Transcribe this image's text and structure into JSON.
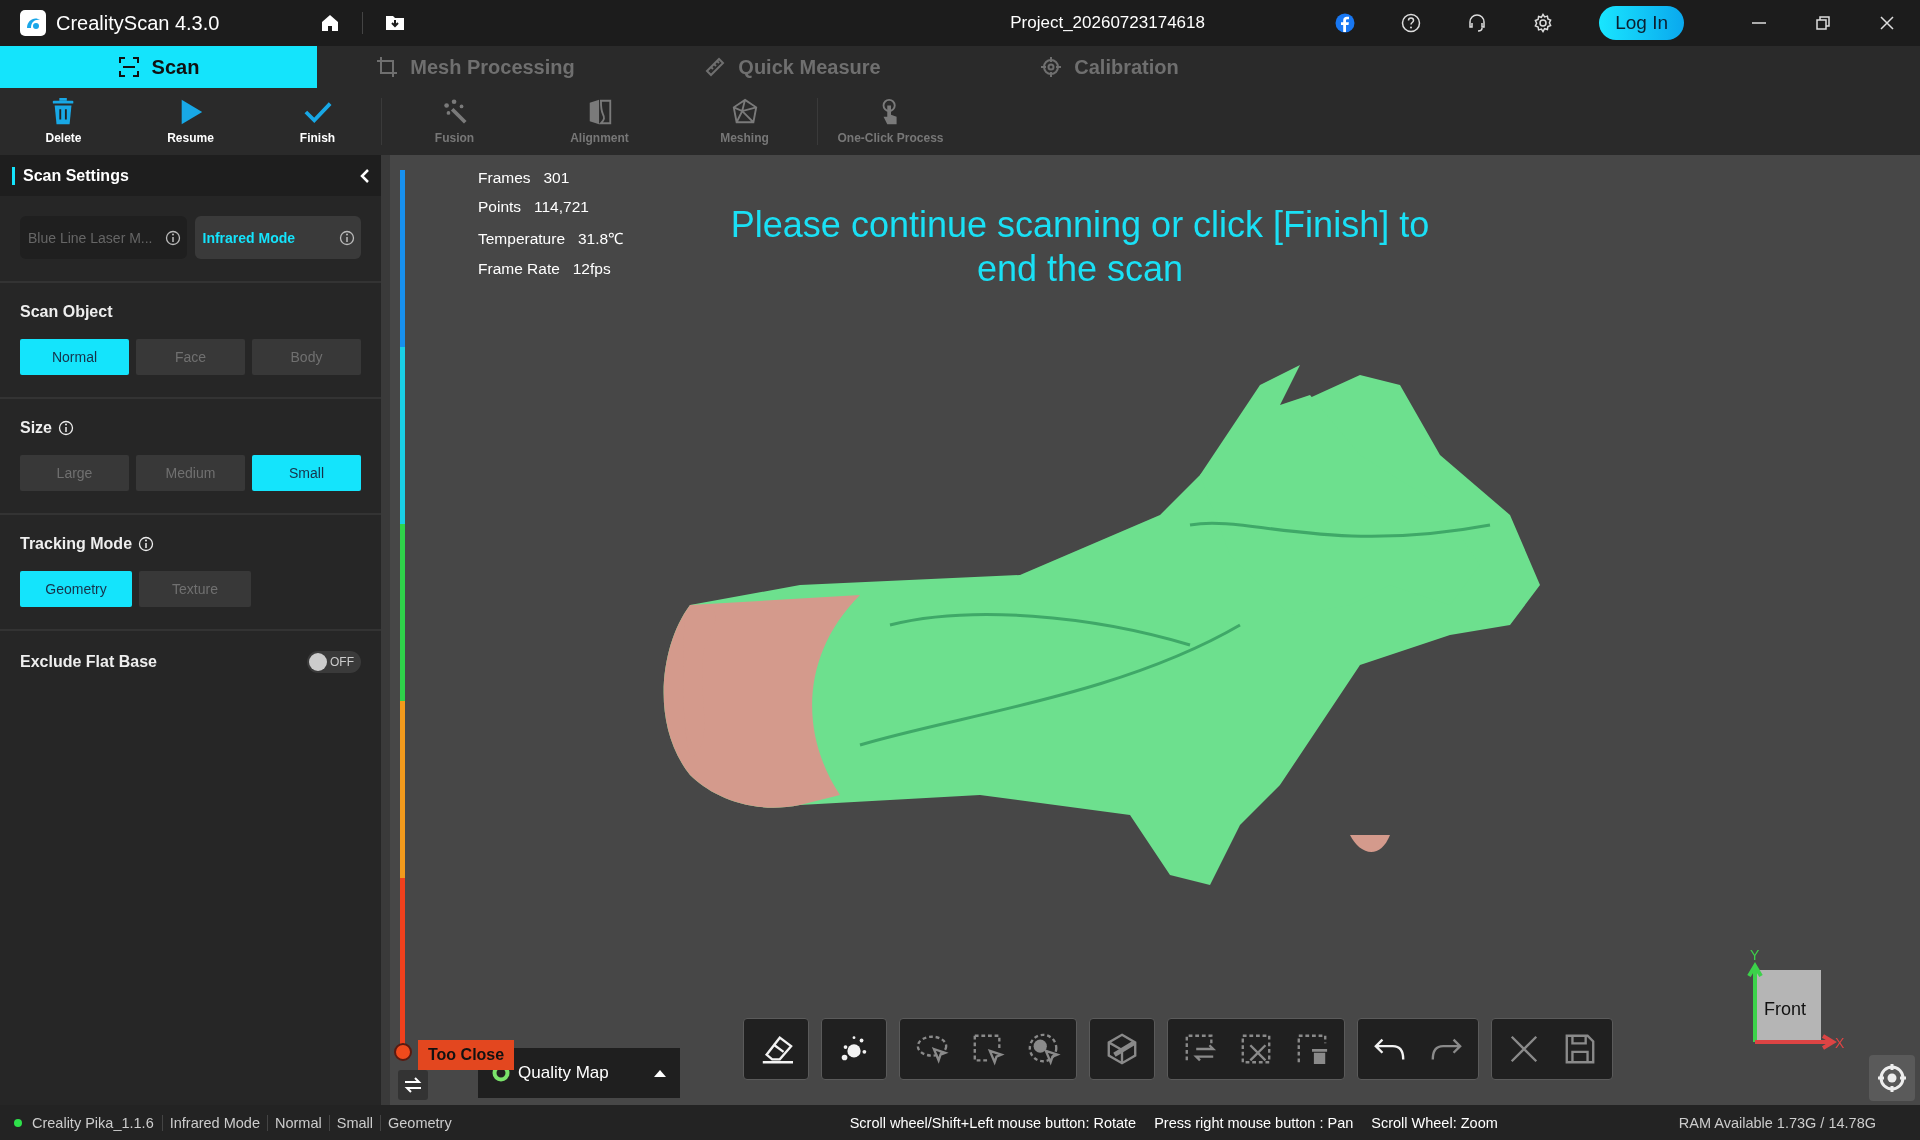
{
  "title_bar": {
    "app_name": "CrealityScan 4.3.0",
    "project": "Project_20260723174618",
    "login": "Log In"
  },
  "tabs": [
    {
      "label": "Scan",
      "kind": "scan",
      "selected": true
    },
    {
      "label": "Mesh Processing",
      "kind": "mesh",
      "selected": false
    },
    {
      "label": "Quick Measure",
      "kind": "measure",
      "selected": false
    },
    {
      "label": "Calibration",
      "kind": "calibration",
      "selected": false
    }
  ],
  "toolbar": [
    {
      "label": "Delete",
      "kind": "delete",
      "disabled": false
    },
    {
      "label": "Resume",
      "kind": "resume",
      "disabled": false
    },
    {
      "label": "Finish",
      "kind": "finish",
      "disabled": false
    },
    {
      "label": "Fusion",
      "kind": "fusion",
      "disabled": true
    },
    {
      "label": "Alignment",
      "kind": "alignment",
      "disabled": true
    },
    {
      "label": "Meshing",
      "kind": "meshing",
      "disabled": true
    },
    {
      "label": "One-Click Process",
      "kind": "oneclick",
      "disabled": true
    }
  ],
  "scan_settings": {
    "title": "Scan Settings",
    "modes": [
      {
        "label": "Blue Line Laser M...",
        "selected": false
      },
      {
        "label": "Infrared Mode",
        "selected": true
      }
    ],
    "sections": [
      {
        "kind": "options",
        "title": "Scan Object",
        "info": false,
        "options": [
          {
            "label": "Normal",
            "selected": true
          },
          {
            "label": "Face",
            "selected": false
          },
          {
            "label": "Body",
            "selected": false
          }
        ]
      },
      {
        "kind": "options",
        "title": "Size",
        "info": true,
        "options": [
          {
            "label": "Large",
            "selected": false
          },
          {
            "label": "Medium",
            "selected": false
          },
          {
            "label": "Small",
            "selected": true
          }
        ]
      },
      {
        "kind": "options",
        "title": "Tracking Mode",
        "info": true,
        "options": [
          {
            "label": "Geometry",
            "selected": true
          },
          {
            "label": "Texture",
            "selected": false
          }
        ]
      },
      {
        "kind": "toggle",
        "title": "Exclude Flat Base",
        "on": false,
        "toggle_text": "OFF"
      }
    ]
  },
  "viewport": {
    "stats": [
      {
        "label": "Frames",
        "value": "301"
      },
      {
        "label": "Points",
        "value": "114,721"
      },
      {
        "label": "Temperature",
        "value": "31.8℃"
      },
      {
        "label": "Frame Rate",
        "value": "12fps"
      }
    ],
    "message": "Please continue scanning or click [Finish] to end the scan",
    "distance_label": "Too Close",
    "quality_map": "Quality Map",
    "tool_groups": [
      {
        "tools": [
          {
            "kind": "eraser",
            "disabled": false
          }
        ]
      },
      {
        "tools": [
          {
            "kind": "dots",
            "disabled": false
          }
        ]
      },
      {
        "tools": [
          {
            "kind": "lasso",
            "disabled": true
          },
          {
            "kind": "rect",
            "disabled": true
          },
          {
            "kind": "paint",
            "disabled": true
          }
        ]
      },
      {
        "tools": [
          {
            "kind": "cube",
            "disabled": true
          }
        ]
      },
      {
        "tools": [
          {
            "kind": "swap",
            "disabled": true
          },
          {
            "kind": "unselect",
            "disabled": true
          },
          {
            "kind": "trash",
            "disabled": true
          }
        ]
      },
      {
        "tools": [
          {
            "kind": "undo",
            "disabled": false
          },
          {
            "kind": "redo",
            "disabled": true
          }
        ]
      },
      {
        "tools": [
          {
            "kind": "close",
            "disabled": true
          },
          {
            "kind": "save",
            "disabled": true
          }
        ]
      }
    ],
    "axis": {
      "y": "Y",
      "x": "X",
      "face": "Front"
    }
  },
  "status_bar": {
    "device": "Creality Pika_1.1.6",
    "items": [
      "Infrared Mode",
      "Normal",
      "Small",
      "Geometry"
    ],
    "hints": [
      "Scroll wheel/Shift+Left mouse button: Rotate",
      "Press right mouse button : Pan",
      "Scroll Wheel: Zoom"
    ],
    "ram": "RAM Available 1.73G / 14.78G"
  }
}
